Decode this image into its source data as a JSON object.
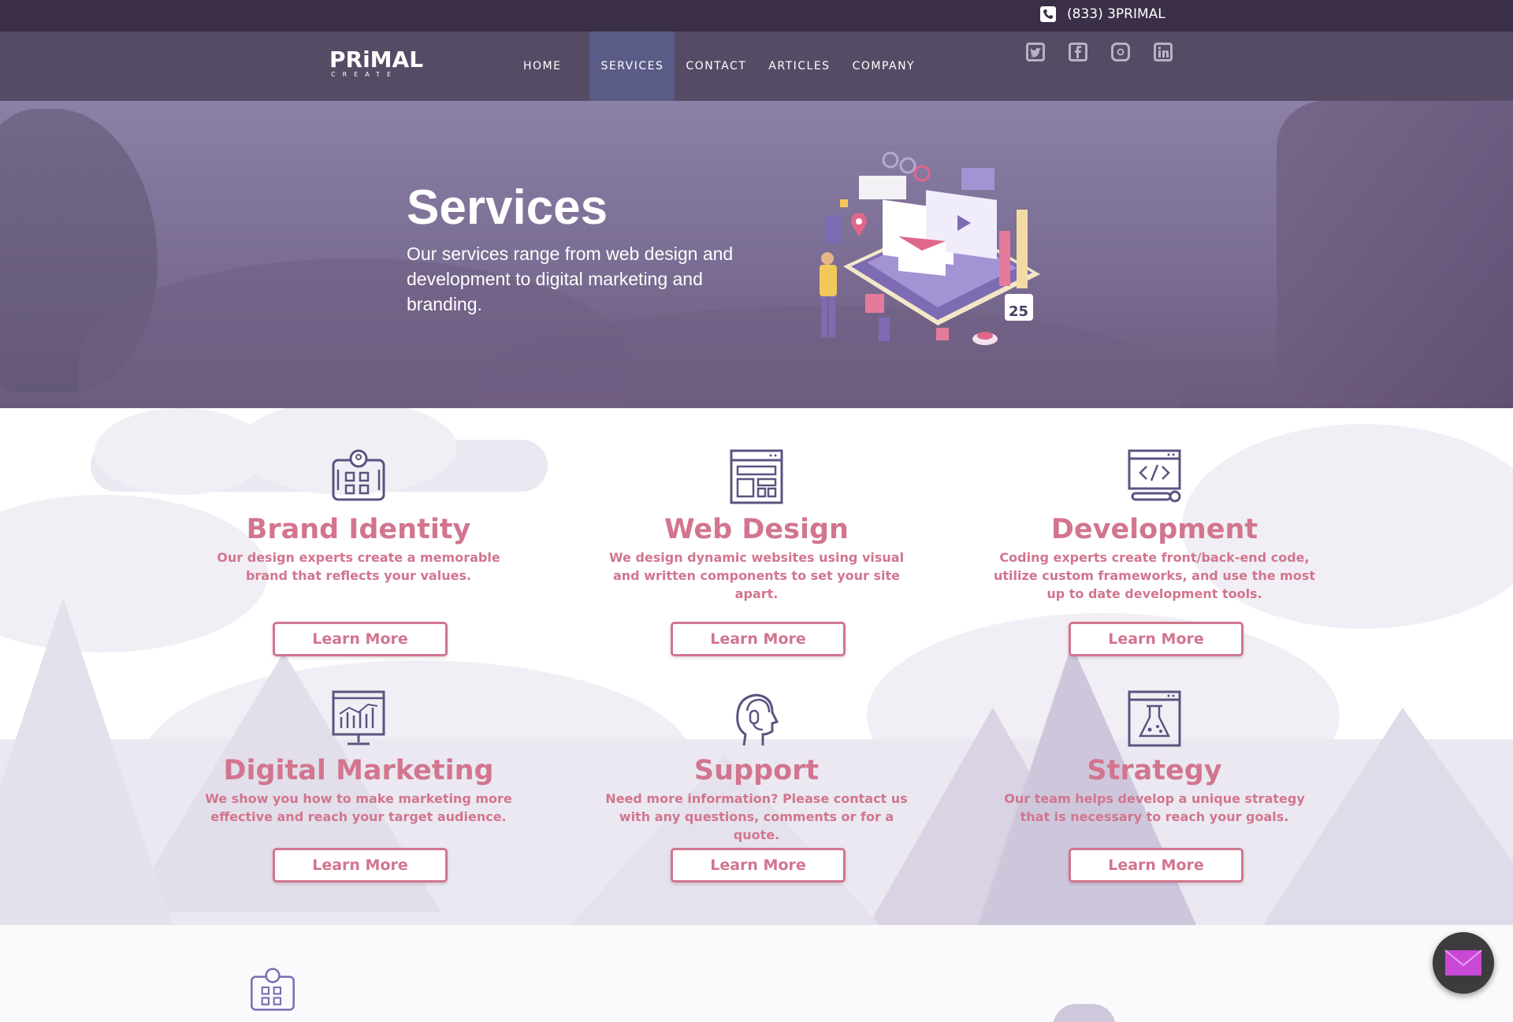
{
  "topbar": {
    "phone": "(833) 3PRIMAL"
  },
  "logo": {
    "main": "PRiMAL",
    "sub": "CREATE"
  },
  "nav": [
    {
      "label": "HOME"
    },
    {
      "label": "SERVICES"
    },
    {
      "label": "CONTACT"
    },
    {
      "label": "ARTICLES"
    },
    {
      "label": "COMPANY"
    }
  ],
  "socials": [
    "twitter-icon",
    "facebook-icon",
    "instagram-icon",
    "linkedin-icon"
  ],
  "hero": {
    "title": "Services",
    "subtitle": "Our services range from web design and development to digital marketing and branding."
  },
  "services": [
    {
      "title": "Brand Identity",
      "desc": "Our design experts create a memorable brand that reflects your values.",
      "button": "Learn More",
      "icon": "brand-identity-icon"
    },
    {
      "title": "Web Design",
      "desc": "We design dynamic websites using visual and written components to set your site apart.",
      "button": "Learn More",
      "icon": "web-design-icon"
    },
    {
      "title": "Development",
      "desc": "Coding experts create front/back-end code, utilize custom frameworks, and use the most up to date development tools.",
      "button": "Learn More",
      "icon": "development-icon"
    },
    {
      "title": "Digital Marketing",
      "desc": "We show you how to make marketing more effective and reach your target audience.",
      "button": "Learn More",
      "icon": "digital-marketing-icon"
    },
    {
      "title": "Support",
      "desc": "Need more information? Please contact us with any questions, comments or for a quote.",
      "button": "Learn More",
      "icon": "support-icon"
    },
    {
      "title": "Strategy",
      "desc": "Our team helps develop a unique strategy that is necessary to reach your goals.",
      "button": "Learn More",
      "icon": "strategy-icon"
    }
  ],
  "colors": {
    "accent": "#d2758e",
    "icon": "#5c5380",
    "topbar": "#3a2f47",
    "nav_active": "#5a5b86"
  }
}
